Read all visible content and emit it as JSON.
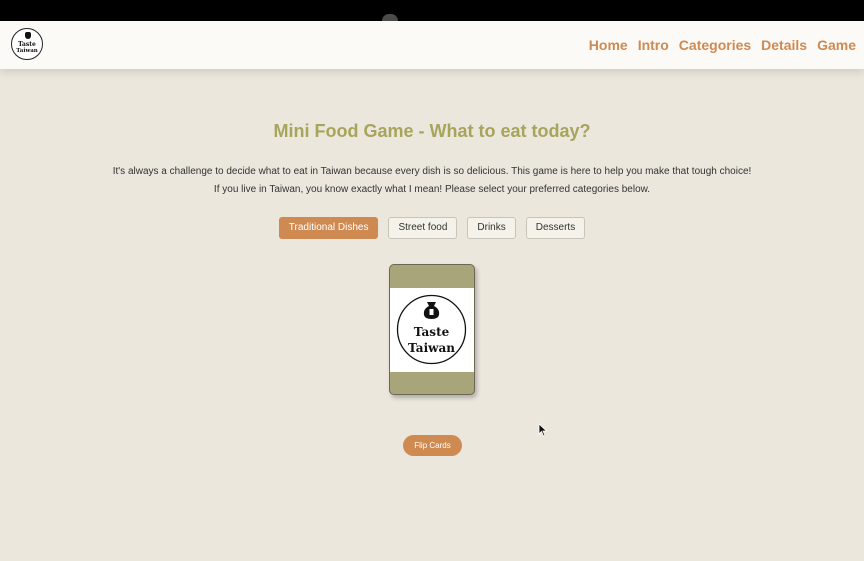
{
  "nav": {
    "logo": {
      "line1": "Taste",
      "line2": "Taiwan"
    },
    "links": [
      "Home",
      "Intro",
      "Categories",
      "Details",
      "Game"
    ]
  },
  "main": {
    "title": "Mini Food Game - What to eat today?",
    "description_line1": "It's always a challenge to decide what to eat in Taiwan because every dish is so delicious. This game is here to help you make that tough choice!",
    "description_line2": "If you live in Taiwan, you know exactly what I mean! Please select your preferred categories below.",
    "categories": [
      {
        "label": "Traditional Dishes",
        "selected": true
      },
      {
        "label": "Street food",
        "selected": false
      },
      {
        "label": "Drinks",
        "selected": false
      },
      {
        "label": "Desserts",
        "selected": false
      }
    ],
    "card": {
      "logo_line1": "Taste",
      "logo_line2": "Taiwan"
    },
    "flip_button": "Flip Cards"
  },
  "colors": {
    "accent": "#cf8a52",
    "title": "#a8a45c",
    "background": "#ebe7dd",
    "card": "#a8a57a"
  },
  "icons": [
    "logo-icon",
    "cursor-icon"
  ]
}
